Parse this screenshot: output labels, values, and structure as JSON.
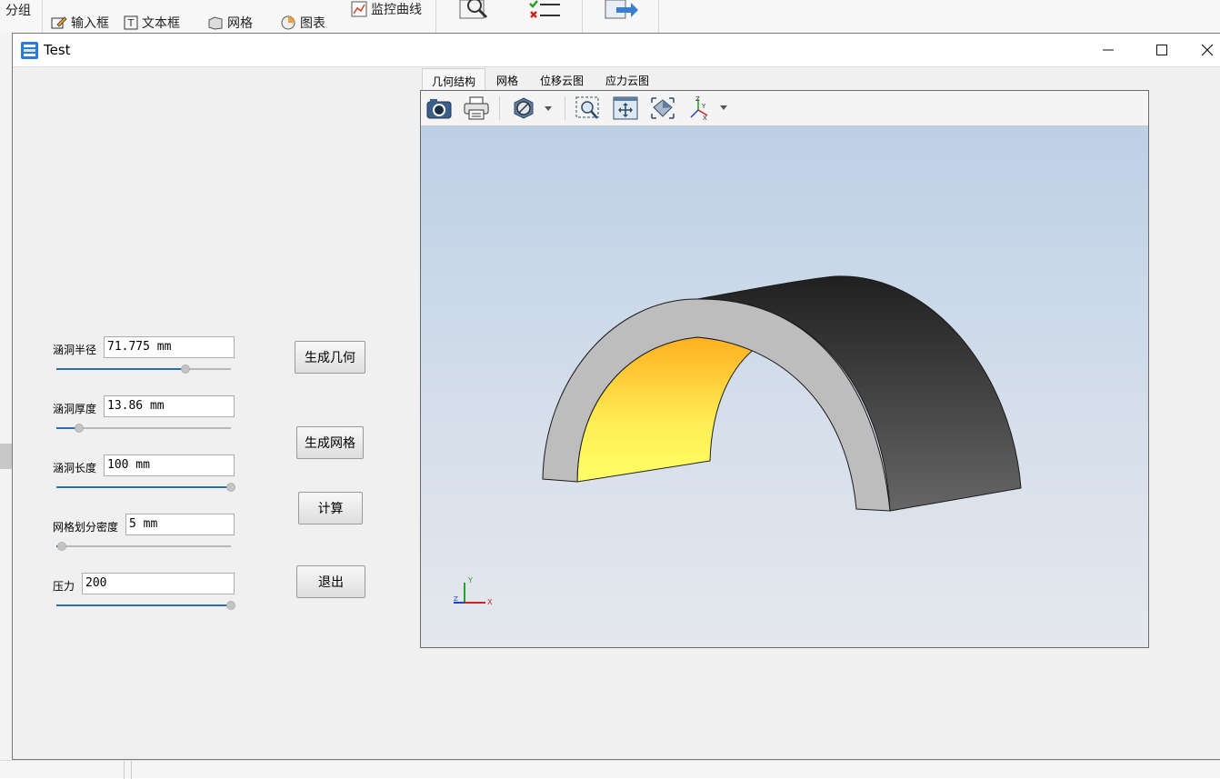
{
  "host_toolbar": {
    "group_label": "分组",
    "input_box": "输入框",
    "text_box": "文本框",
    "mesh": "网格",
    "chart": "图表",
    "monitor_curve": "监控曲线"
  },
  "window": {
    "title": "Test"
  },
  "form": {
    "radius": {
      "label": "涵洞半径",
      "value": "71.775 mm",
      "slider_fraction": 0.74
    },
    "thickness": {
      "label": "涵洞厚度",
      "value": "13.86 mm",
      "slider_fraction": 0.13
    },
    "length": {
      "label": "涵洞长度",
      "value": "100 mm",
      "slider_fraction": 1.0
    },
    "mesh_density": {
      "label": "网格划分密度",
      "value": "5 mm",
      "slider_fraction": 0.03
    },
    "pressure": {
      "label": "压力",
      "value": "200",
      "slider_fraction": 1.0
    }
  },
  "buttons": {
    "gen_geometry": "生成几何",
    "gen_mesh": "生成网格",
    "compute": "计算",
    "exit": "退出"
  },
  "tabs": [
    {
      "label": "几何结构",
      "active": true
    },
    {
      "label": "网格",
      "active": false
    },
    {
      "label": "位移云图",
      "active": false
    },
    {
      "label": "应力云图",
      "active": false
    }
  ],
  "viewer_toolbar": [
    "camera-icon",
    "printer-icon",
    "display-mode-icon",
    "zoom-window-icon",
    "fit-all-icon",
    "view-iso-icon",
    "axes-icon"
  ],
  "triad": {
    "x": "X",
    "y": "Y",
    "z": "Z"
  },
  "colors": {
    "accent": "#2b6cb0",
    "inner_surface_top": "#ffb020",
    "inner_surface_bottom": "#ffff66",
    "outer_surface": "#555555",
    "face": "#bcbcbc"
  }
}
